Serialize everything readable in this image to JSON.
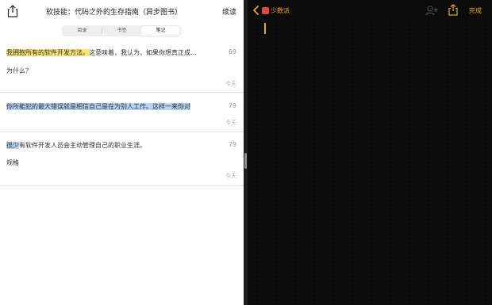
{
  "left": {
    "title": "软技能：代码之外的生存指南（异步图书）",
    "continue_label": "续读",
    "tabs": [
      {
        "label": "目录"
      },
      {
        "label": "书签"
      },
      {
        "label": "笔记",
        "active": true
      }
    ],
    "notes": [
      {
        "highlight": "我拥抱所有的软件开发方法。",
        "rest": "这意味着，我认为，如果你想真正成…",
        "color": "#fbe574",
        "count": "69",
        "comment": "为什么？",
        "date": "今天"
      },
      {
        "highlight": "你所能犯的最大错误就是相信自己是在为别人工作。这样一来你对",
        "rest": "",
        "color": "#b7d3f1",
        "count": "79",
        "comment": "",
        "date": "今天"
      },
      {
        "highlight": "很少",
        "rest": "有软件开发人员会主动管理自己的职业生涯。",
        "color": "#b7d3f1",
        "count": "79",
        "comment": "规格",
        "date": "今天"
      }
    ]
  },
  "right": {
    "back_label": "少数派",
    "done_label": "完成",
    "accent": "#e8a917"
  }
}
